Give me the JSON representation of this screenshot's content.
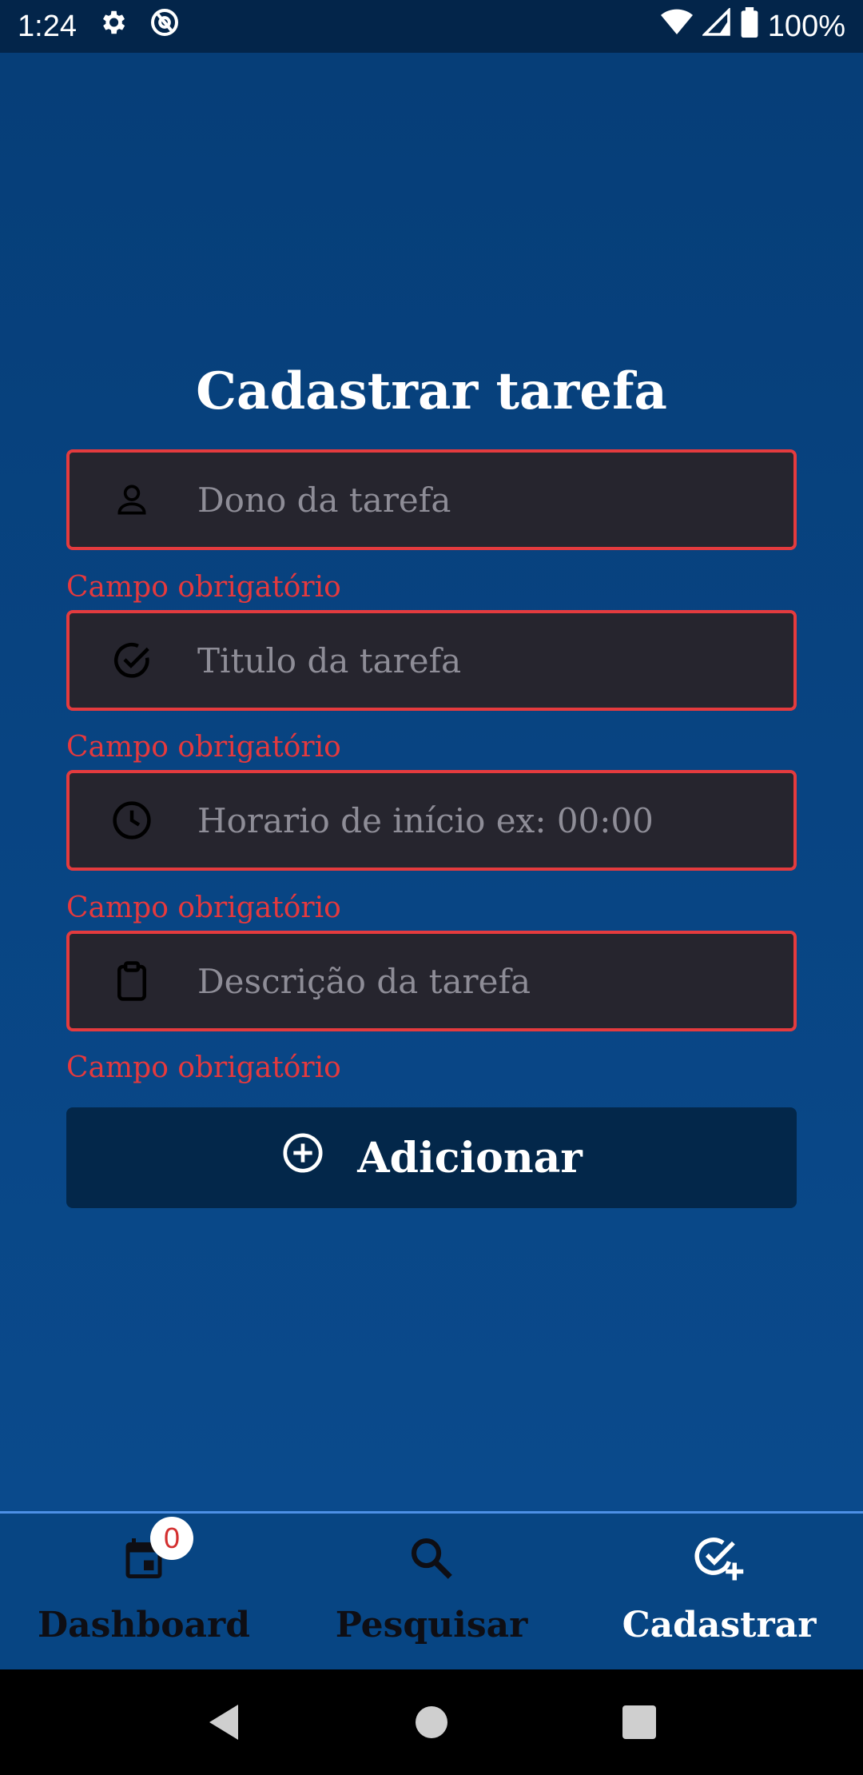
{
  "status_bar": {
    "time": "1:24",
    "battery": "100%",
    "icons": [
      "settings-icon",
      "at-sign-icon",
      "wifi-icon",
      "signal-icon",
      "battery-icon"
    ]
  },
  "page": {
    "title": "Cadastrar tarefa"
  },
  "form": {
    "fields": [
      {
        "icon": "person-icon",
        "placeholder": "Dono da tarefa",
        "value": "",
        "error": "Campo obrigatório"
      },
      {
        "icon": "check-circle-icon",
        "placeholder": "Titulo da tarefa",
        "value": "",
        "error": "Campo obrigatório"
      },
      {
        "icon": "clock-icon",
        "placeholder": "Horario de início ex: 00:00",
        "value": "",
        "error": "Campo obrigatório"
      },
      {
        "icon": "clipboard-icon",
        "placeholder": "Descrição da tarefa",
        "value": "",
        "error": "Campo obrigatório"
      }
    ],
    "submit_label": "Adicionar",
    "submit_icon": "plus-circle-icon"
  },
  "bottom_nav": {
    "items": [
      {
        "label": "Dashboard",
        "icon": "calendar-icon",
        "badge": "0",
        "active": false
      },
      {
        "label": "Pesquisar",
        "icon": "search-icon",
        "active": false
      },
      {
        "label": "Cadastrar",
        "icon": "check-add-icon",
        "active": true
      }
    ]
  },
  "colors": {
    "background": "#063b73",
    "field_background": "#26252e",
    "error": "#e43b3e",
    "button": "#03274a",
    "status_bar": "#03254a"
  }
}
